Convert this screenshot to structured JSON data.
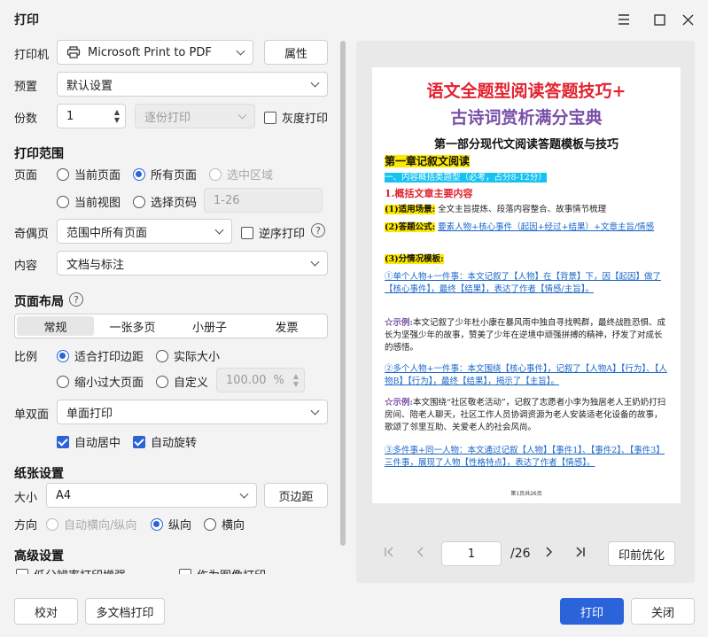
{
  "window": {
    "title": "打印"
  },
  "printer": {
    "label": "打印机",
    "value": "Microsoft Print to PDF",
    "props_button": "属性"
  },
  "preset": {
    "label": "预置",
    "value": "默认设置"
  },
  "copies": {
    "label": "份数",
    "value": "1",
    "collate": "逐份打印",
    "grayscale": "灰度打印"
  },
  "range": {
    "section": "打印范围",
    "pages_label": "页面",
    "current_page": "当前页面",
    "all_pages": "所有页面",
    "selection": "选中区域",
    "current_view": "当前视图",
    "select_pages": "选择页码",
    "pages_placeholder": "1-26",
    "odd_even_label": "奇偶页",
    "odd_even_value": "范围中所有页面",
    "reverse": "逆序打印",
    "content_label": "内容",
    "content_value": "文档与标注"
  },
  "layout": {
    "section": "页面布局",
    "tabs": [
      "常规",
      "一张多页",
      "小册子",
      "发票"
    ],
    "scale_label": "比例",
    "fit_margin": "适合打印边距",
    "actual_size": "实际大小",
    "shrink": "缩小过大页面",
    "custom": "自定义",
    "custom_value": "100.00",
    "custom_unit": "%",
    "duplex_label": "单双面",
    "duplex_value": "单面打印",
    "auto_center": "自动居中",
    "auto_rotate": "自动旋转"
  },
  "paper": {
    "section": "纸张设置",
    "size_label": "大小",
    "size_value": "A4",
    "margin_button": "页边距",
    "orient_label": "方向",
    "auto_orient": "自动横向/纵向",
    "portrait": "纵向",
    "landscape": "横向"
  },
  "advanced": {
    "section": "高级设置",
    "opt1": "低分辨率打印增强",
    "opt2": "作为图像打印"
  },
  "footer": {
    "proof": "校对",
    "multi": "多文档打印",
    "print": "打印",
    "close": "关闭"
  },
  "preview": {
    "page_input": "1",
    "total": "/26",
    "optimize": "印前优化",
    "doc": {
      "title1": "语文全题型阅读答题技巧+",
      "title2": "古诗词赏析满分宝典",
      "part": "第一部分现代文阅读答题模板与技巧",
      "chapter": "第一章记叙文阅读",
      "section1": "一、内容概括类题型（必考，占分8-12分）",
      "item1": "1.概括文章主要内容",
      "scene_tag": "(1)适用场景:",
      "scene_text": "全文主旨提炼、段落内容整合、故事情节梳理",
      "formula_tag": "(2)答题公式:",
      "formula_text": "要素人物+核心事件（起因+经过+结果）+文章主旨/情感",
      "template_tag": "(3)分情况模板:",
      "t1": "①单个人物+一件事：本文记叙了【人物】在【背景】下，因【起因】做了【核心事件】，最终【结果】，表达了作者【情感/主旨】。",
      "ex_tag": "☆示例:",
      "ex1": "本文记叙了少年杜小康在暴风雨中独自寻找鸭群，最终战胜恐惧、成长为坚强少年的故事，赞美了少年在逆境中顽强拼搏的精神，抒发了对成长的感悟。",
      "t2": "②多个人物+一件事：本文围绕【核心事件】，记叙了【人物A】【行为】、【人物B】【行为】，最终【结果】，揭示了【主旨】。",
      "ex2": "本文围绕“社区敬老活动”，记叙了志愿者小李为独居老人王奶奶打扫房间、陪老人聊天，社区工作人员协调资源为老人安装适老化设备的故事，歌颂了邻里互助、关爱老人的社会风尚。",
      "t3": "③多件事+同一人物：本文通过记叙【人物】【事件1】、【事件2】、【事件3】三件事，展现了人物【性格特点】，表达了作者【情感】。",
      "page_footer": "第1页共26页"
    }
  }
}
